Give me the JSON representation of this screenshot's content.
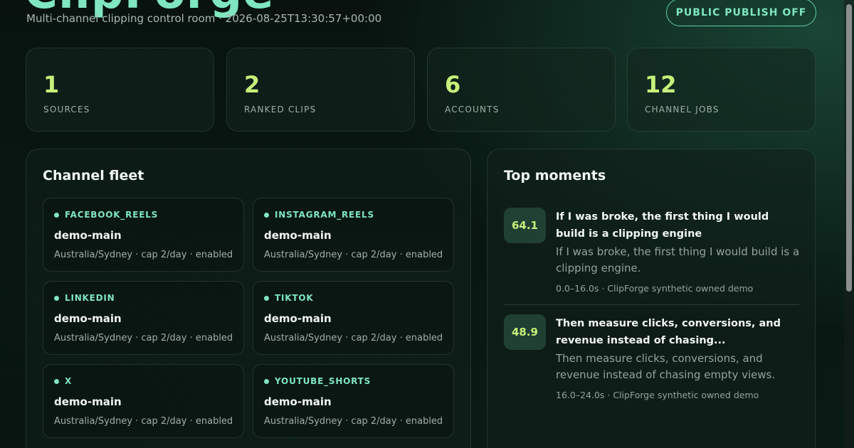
{
  "header": {
    "title": "ClipForge",
    "subtitle": "Multi-channel clipping control room · 2026-08-25T13:30:57+00:00",
    "publish_button": "PUBLIC PUBLISH OFF"
  },
  "stats": [
    {
      "value": "1",
      "label": "SOURCES"
    },
    {
      "value": "2",
      "label": "RANKED CLIPS"
    },
    {
      "value": "6",
      "label": "ACCOUNTS"
    },
    {
      "value": "12",
      "label": "CHANNEL JOBS"
    }
  ],
  "channel_fleet": {
    "title": "Channel fleet",
    "channels": [
      {
        "platform": "FACEBOOK_REELS",
        "account": "demo-main",
        "meta": "Australia/Sydney · cap 2/day · enabled"
      },
      {
        "platform": "INSTAGRAM_REELS",
        "account": "demo-main",
        "meta": "Australia/Sydney · cap 2/day · enabled"
      },
      {
        "platform": "LINKEDIN",
        "account": "demo-main",
        "meta": "Australia/Sydney · cap 2/day · enabled"
      },
      {
        "platform": "TIKTOK",
        "account": "demo-main",
        "meta": "Australia/Sydney · cap 2/day · enabled"
      },
      {
        "platform": "X",
        "account": "demo-main",
        "meta": "Australia/Sydney · cap 2/day · enabled"
      },
      {
        "platform": "YOUTUBE_SHORTS",
        "account": "demo-main",
        "meta": "Australia/Sydney · cap 2/day · enabled"
      }
    ]
  },
  "top_moments": {
    "title": "Top moments",
    "items": [
      {
        "score": "64.1",
        "title": "If I was broke, the first thing I would build is a clipping engine",
        "text": "If I was broke, the first thing I would build is a clipping engine.",
        "meta": "0.0–16.0s · ClipForge synthetic owned demo"
      },
      {
        "score": "48.9",
        "title": "Then measure clicks, conversions, and revenue instead of chasing...",
        "text": "Then measure clicks, conversions, and revenue instead of chasing empty views.",
        "meta": "16.0–24.0s · ClipForge synthetic owned demo"
      }
    ]
  },
  "colors": {
    "accent": "#7fe6c0",
    "stat_value": "#c6f07a",
    "background": "#0a1a15"
  }
}
